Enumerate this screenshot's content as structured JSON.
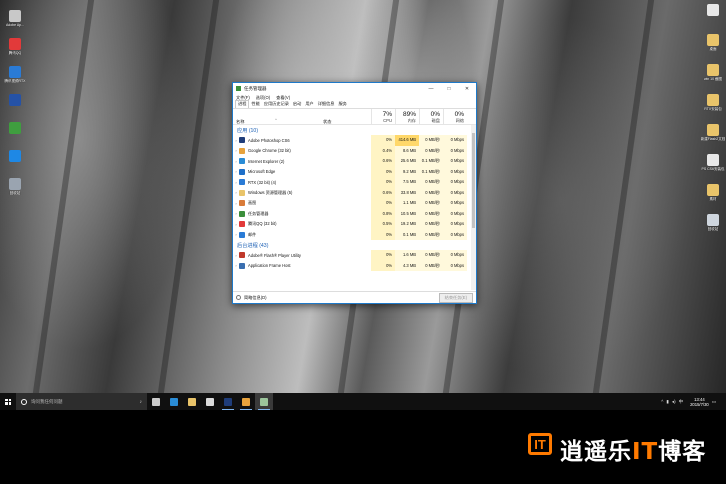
{
  "desktop": {
    "left_icons": [
      {
        "label": "Adobe Ap...",
        "color": "#c8c8c8"
      },
      {
        "label": "腾讯QQ",
        "color": "#e23a3a"
      },
      {
        "label": "腾讯视频RTX",
        "color": "#2a7bd6"
      },
      {
        "label": "",
        "color": "#2552a6"
      },
      {
        "label": "",
        "color": "#3f9e3f"
      },
      {
        "label": "",
        "color": "#1e88e5"
      },
      {
        "label": "回收站",
        "color": "#9aa4b0"
      }
    ],
    "right_icons": [
      {
        "label": "",
        "color": "#e8e8e8"
      },
      {
        "label": "桌面",
        "color": "#e9c46a"
      },
      {
        "label": "win 10 截图",
        "color": "#e9c46a"
      },
      {
        "label": "RTX安装包",
        "color": "#e9c46a"
      },
      {
        "label": "新建Flash2文档",
        "color": "#e9c46a"
      },
      {
        "label": "PS CS6安装包",
        "color": "#e8e8e8"
      },
      {
        "label": "素材",
        "color": "#e9c46a"
      },
      {
        "label": "回收站",
        "color": "#cfd6de"
      }
    ]
  },
  "taskmgr": {
    "title": "任务管理器",
    "controls": {
      "minimize": "—",
      "maximize": "□",
      "close": "✕"
    },
    "menu": [
      "文件(F)",
      "选项(O)",
      "查看(V)"
    ],
    "tabs": [
      "进程",
      "性能",
      "应用历史记录",
      "启动",
      "用户",
      "详细信息",
      "服务"
    ],
    "columns": {
      "name": "名称",
      "status": "状态",
      "cpu": {
        "pct": "7%",
        "label": "CPU"
      },
      "mem": {
        "pct": "89%",
        "label": "内存"
      },
      "disk": {
        "pct": "0%",
        "label": "磁盘"
      },
      "net": {
        "pct": "0%",
        "label": "网络"
      }
    },
    "apps_group": "应用 (10)",
    "apps": [
      {
        "name": "Adobe Photoshop CS6",
        "cpu": "0%",
        "mem": "414.6 MB",
        "disk": "0 MB/秒",
        "net": "0 Mbps",
        "color": "#1f3d7a",
        "hot": true
      },
      {
        "name": "Google Chrome (32 bit)",
        "cpu": "0.4%",
        "mem": "8.6 MB",
        "disk": "0 MB/秒",
        "net": "0 Mbps",
        "color": "#e8a33d",
        "hot": false
      },
      {
        "name": "Internet Explorer (2)",
        "cpu": "0.6%",
        "mem": "25.6 MB",
        "disk": "0.1 MB/秒",
        "net": "0 Mbps",
        "color": "#2a8cd6",
        "hot": false
      },
      {
        "name": "Microsoft Edge",
        "cpu": "0%",
        "mem": "9.2 MB",
        "disk": "0.1 MB/秒",
        "net": "0 Mbps",
        "color": "#1e6fc8",
        "hot": false
      },
      {
        "name": "RTX (32 bit) (4)",
        "cpu": "0%",
        "mem": "7.5 MB",
        "disk": "0 MB/秒",
        "net": "0 Mbps",
        "color": "#2a7bd6",
        "hot": false
      },
      {
        "name": "Windows 资源管理器 (5)",
        "cpu": "0.6%",
        "mem": "33.8 MB",
        "disk": "0 MB/秒",
        "net": "0 Mbps",
        "color": "#e9c46a",
        "hot": false
      },
      {
        "name": "画图",
        "cpu": "0%",
        "mem": "1.1 MB",
        "disk": "0 MB/秒",
        "net": "0 Mbps",
        "color": "#d97b3a",
        "hot": false
      },
      {
        "name": "任务管理器",
        "cpu": "0.8%",
        "mem": "10.5 MB",
        "disk": "0 MB/秒",
        "net": "0 Mbps",
        "color": "#3b8f3b",
        "hot": false
      },
      {
        "name": "腾讯QQ (32 bit)",
        "cpu": "0.5%",
        "mem": "19.2 MB",
        "disk": "0 MB/秒",
        "net": "0 Mbps",
        "color": "#e23a3a",
        "hot": false
      },
      {
        "name": "邮件",
        "cpu": "0%",
        "mem": "0.1 MB",
        "disk": "0 MB/秒",
        "net": "0 Mbps",
        "color": "#2a7bd6",
        "hot": false
      }
    ],
    "bg_group": "后台进程 (43)",
    "bg": [
      {
        "name": "Adobe® Flash® Player Utility",
        "cpu": "0%",
        "mem": "1.6 MB",
        "disk": "0 MB/秒",
        "net": "0 Mbps",
        "color": "#c0392b"
      },
      {
        "name": "Application Frame Host",
        "cpu": "0%",
        "mem": "4.3 MB",
        "disk": "0 MB/秒",
        "net": "0 Mbps",
        "color": "#3a6fb0"
      }
    ],
    "fewer_details": "简略信息(D)",
    "end_task": "结束任务(E)"
  },
  "taskbar": {
    "search_placeholder": "询问我任何问题",
    "apps": [
      {
        "name": "task-view",
        "color": "#cccccc"
      },
      {
        "name": "edge",
        "color": "#2a8cd6"
      },
      {
        "name": "file-explorer",
        "color": "#e9c46a"
      },
      {
        "name": "store",
        "color": "#dddddd"
      },
      {
        "name": "photoshop",
        "color": "#1f3d7a"
      },
      {
        "name": "chrome",
        "color": "#e8a33d"
      },
      {
        "name": "taskmgr",
        "color": "#9cc59c"
      }
    ],
    "time": "13:44",
    "date": "2015/7/30",
    "lang": "中"
  },
  "banner": {
    "brand_part1": "逍遥乐",
    "brand_it": "IT",
    "brand_part2": "博客"
  }
}
